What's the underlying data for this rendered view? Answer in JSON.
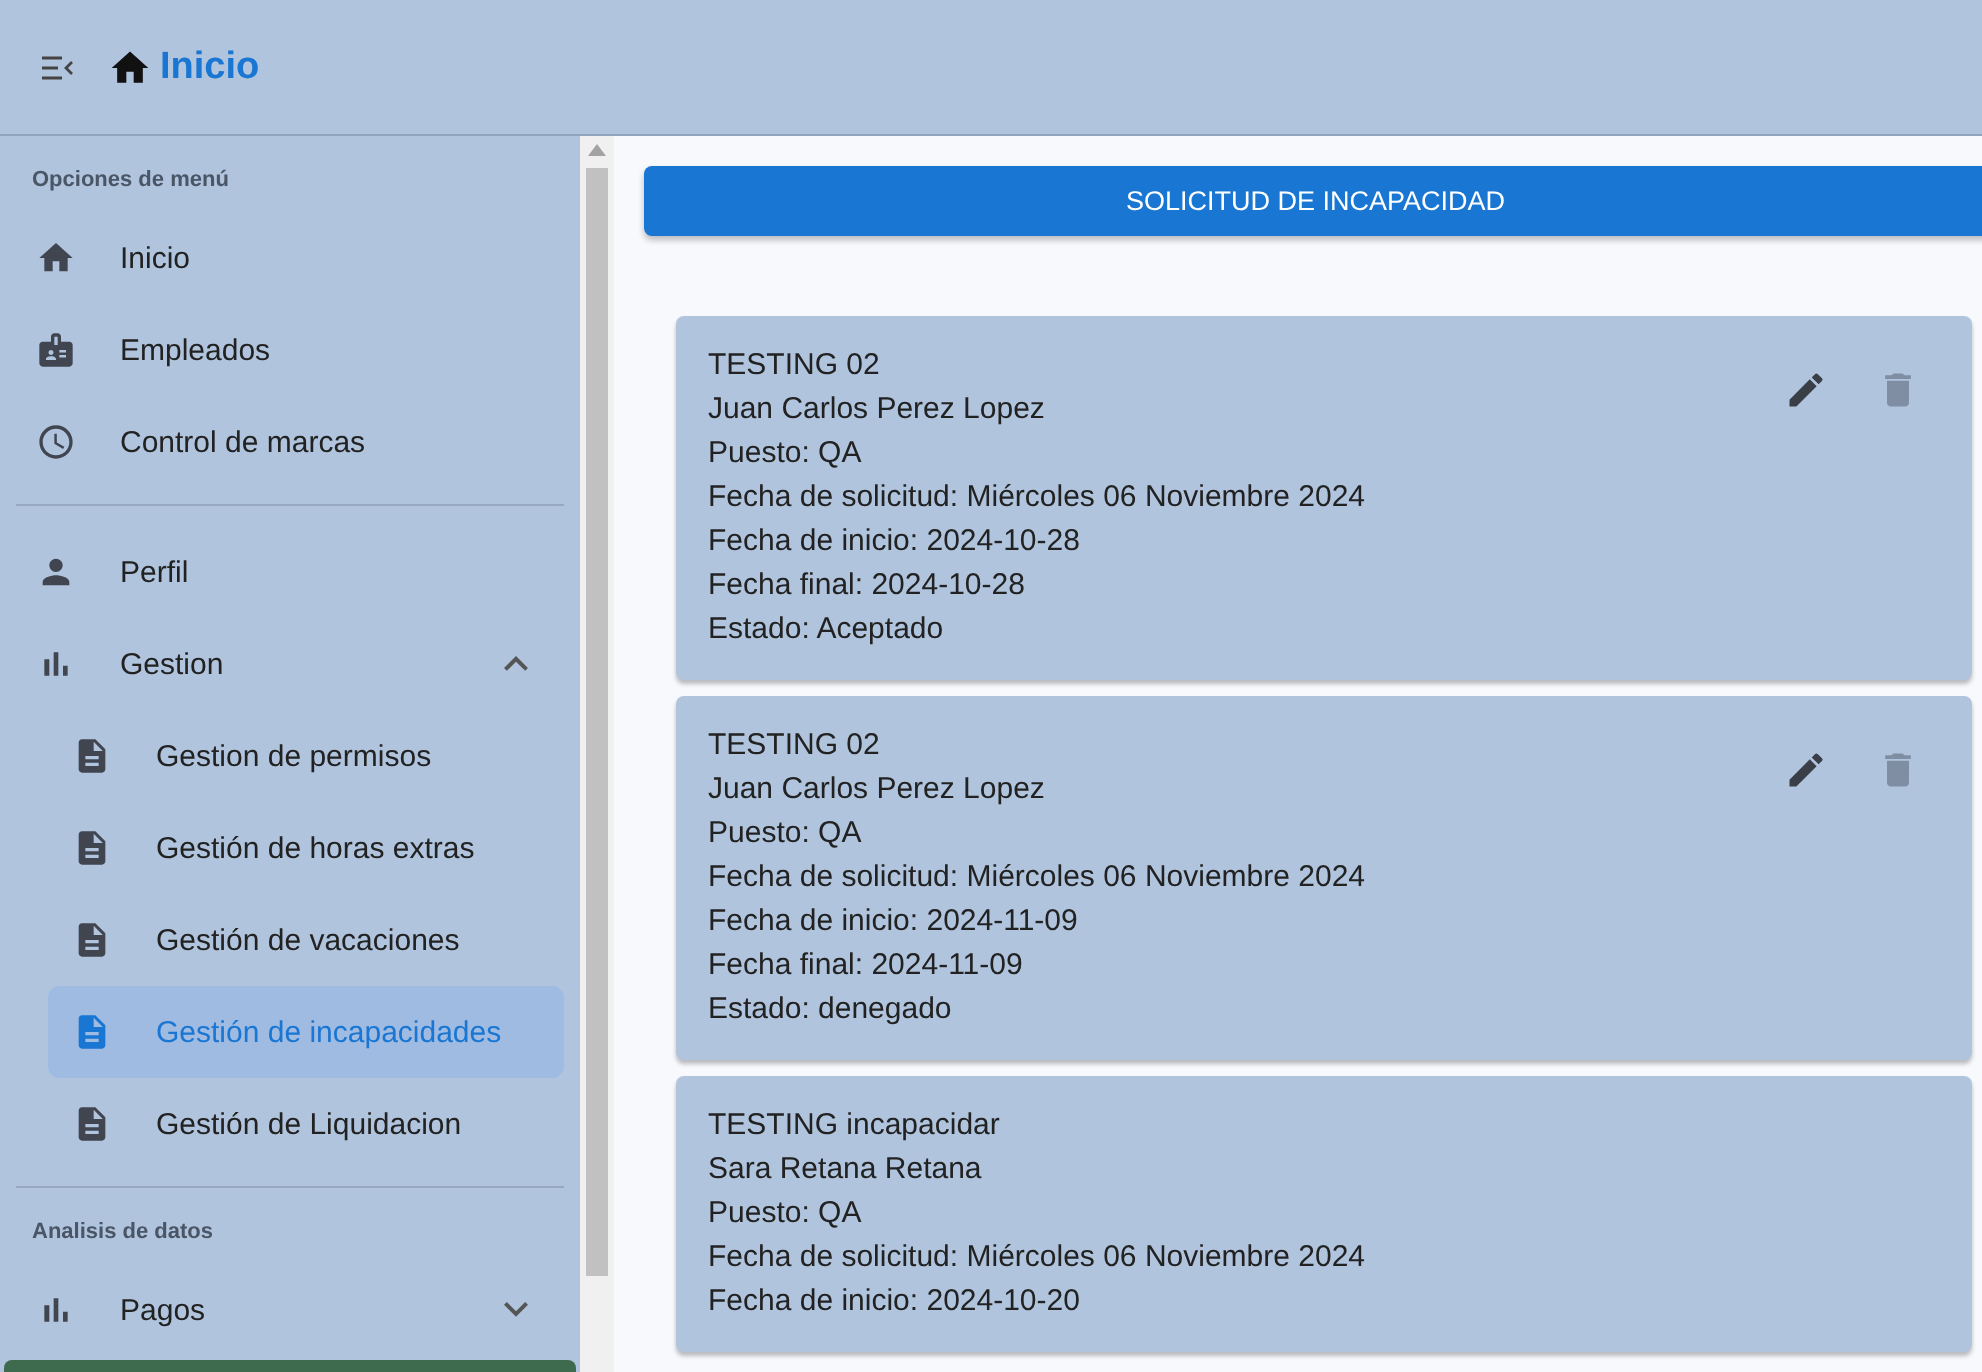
{
  "header": {
    "title": "Inicio"
  },
  "sidebar": {
    "sections": [
      {
        "title": "Opciones de menú",
        "items": [
          {
            "label": "Inicio",
            "selected": false
          },
          {
            "label": "Empleados",
            "selected": false
          },
          {
            "label": "Control de marcas",
            "selected": false
          }
        ]
      },
      {
        "items": [
          {
            "label": "Perfil",
            "selected": false
          },
          {
            "label": "Gestion",
            "selected": false,
            "expanded": true,
            "children": [
              {
                "label": "Gestion de permisos",
                "selected": false
              },
              {
                "label": "Gestión de horas extras",
                "selected": false
              },
              {
                "label": "Gestión de vacaciones",
                "selected": false
              },
              {
                "label": "Gestión de incapacidades",
                "selected": true
              },
              {
                "label": "Gestión de Liquidacion",
                "selected": false
              }
            ]
          }
        ]
      },
      {
        "title": "Analisis de datos",
        "items": [
          {
            "label": "Pagos",
            "selected": false,
            "expanded": false
          }
        ]
      }
    ]
  },
  "main": {
    "button": "SOLICITUD DE INCAPACIDAD",
    "cards": [
      {
        "actions": true,
        "lines": [
          "TESTING 02",
          "Juan Carlos Perez Lopez",
          "Puesto: QA",
          "Fecha de solicitud: Miércoles 06 Noviembre 2024",
          "Fecha de inicio: 2024-10-28",
          "Fecha final: 2024-10-28",
          "Estado: Aceptado"
        ]
      },
      {
        "actions": true,
        "lines": [
          "TESTING 02",
          "Juan Carlos Perez Lopez",
          "Puesto: QA",
          "Fecha de solicitud: Miércoles 06 Noviembre 2024",
          "Fecha de inicio: 2024-11-09",
          "Fecha final: 2024-11-09",
          "Estado: denegado"
        ]
      },
      {
        "actions": false,
        "lines": [
          "TESTING incapacidar",
          "Sara Retana Retana",
          "Puesto: QA",
          "Fecha de solicitud: Miércoles 06 Noviembre 2024",
          "Fecha de inicio: 2024-10-20"
        ]
      }
    ]
  }
}
